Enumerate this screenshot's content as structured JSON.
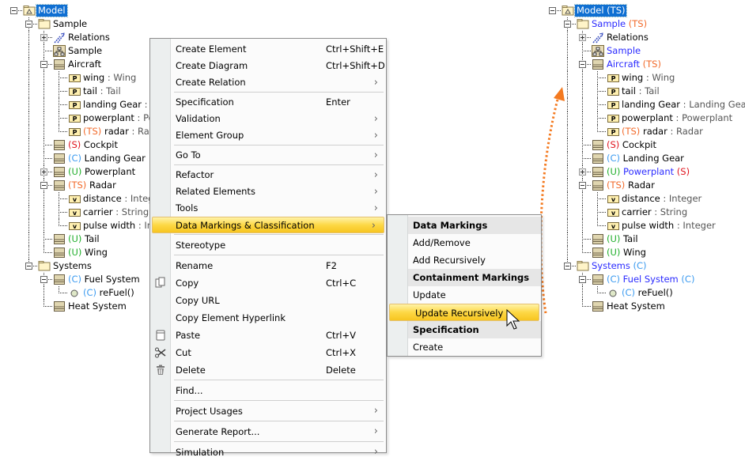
{
  "colors": {
    "accent_selection": "#0f6fd2",
    "highlight": "#fdd845",
    "arrow": "#f47a20",
    "ts": "#f26a2a",
    "s": "#e0141e",
    "c": "#3c9bf0",
    "u": "#1fae2a",
    "modified": "#2a2aff"
  },
  "left_tree": [
    {
      "level": 0,
      "exp": "minus",
      "icon": "model-icon",
      "parts": [
        {
          "t": "Model",
          "c": "sel"
        }
      ]
    },
    {
      "level": 1,
      "exp": "minus",
      "icon": "folder-icon",
      "parts": [
        {
          "t": "Sample"
        }
      ]
    },
    {
      "level": 2,
      "exp": "plus",
      "icon": "relations-icon",
      "parts": [
        {
          "t": "Relations"
        }
      ]
    },
    {
      "level": 2,
      "icon": "diagram-icon",
      "parts": [
        {
          "t": "Sample"
        }
      ]
    },
    {
      "level": 2,
      "exp": "minus",
      "icon": "block-icon",
      "parts": [
        {
          "t": "Aircraft"
        }
      ]
    },
    {
      "level": 3,
      "icon": "property-icon",
      "parts": [
        {
          "t": "wing"
        },
        {
          "t": " : Wing",
          "c": "type"
        }
      ]
    },
    {
      "level": 3,
      "icon": "property-icon",
      "parts": [
        {
          "t": "tail"
        },
        {
          "t": " : Tail",
          "c": "type"
        }
      ]
    },
    {
      "level": 3,
      "icon": "property-icon",
      "parts": [
        {
          "t": "landing Gear"
        },
        {
          "t": " : Landing Gear",
          "c": "type"
        }
      ]
    },
    {
      "level": 3,
      "icon": "property-icon",
      "parts": [
        {
          "t": "powerplant"
        },
        {
          "t": " : Powerplant",
          "c": "type"
        }
      ]
    },
    {
      "level": 3,
      "icon": "property-icon",
      "parts": [
        {
          "t": "(TS)",
          "c": "ts"
        },
        {
          "t": " radar"
        },
        {
          "t": " : Radar",
          "c": "type"
        }
      ]
    },
    {
      "level": 2,
      "icon": "block-icon",
      "parts": [
        {
          "t": "(S)",
          "c": "s"
        },
        {
          "t": " Cockpit"
        }
      ]
    },
    {
      "level": 2,
      "icon": "block-icon",
      "parts": [
        {
          "t": "(C)",
          "c": "c"
        },
        {
          "t": " Landing Gear"
        }
      ]
    },
    {
      "level": 2,
      "exp": "plus",
      "icon": "block-icon",
      "parts": [
        {
          "t": "(U)",
          "c": "u"
        },
        {
          "t": " Powerplant"
        }
      ]
    },
    {
      "level": 2,
      "exp": "minus",
      "icon": "block-icon",
      "parts": [
        {
          "t": "(TS)",
          "c": "ts"
        },
        {
          "t": " Radar"
        }
      ]
    },
    {
      "level": 3,
      "icon": "value-icon",
      "parts": [
        {
          "t": "distance"
        },
        {
          "t": " : Integer",
          "c": "type"
        }
      ]
    },
    {
      "level": 3,
      "icon": "value-icon",
      "parts": [
        {
          "t": "carrier"
        },
        {
          "t": " : String",
          "c": "type"
        }
      ]
    },
    {
      "level": 3,
      "icon": "value-icon",
      "parts": [
        {
          "t": "pulse width"
        },
        {
          "t": " : Integer",
          "c": "type"
        }
      ]
    },
    {
      "level": 2,
      "icon": "block-icon",
      "parts": [
        {
          "t": "(U)",
          "c": "u"
        },
        {
          "t": " Tail"
        }
      ]
    },
    {
      "level": 2,
      "icon": "block-icon",
      "parts": [
        {
          "t": "(U)",
          "c": "u"
        },
        {
          "t": " Wing"
        }
      ]
    },
    {
      "level": 1,
      "exp": "minus",
      "icon": "folder-icon",
      "parts": [
        {
          "t": "Systems"
        }
      ]
    },
    {
      "level": 2,
      "exp": "minus",
      "icon": "block-icon",
      "parts": [
        {
          "t": "(C)",
          "c": "c"
        },
        {
          "t": " Fuel System"
        }
      ]
    },
    {
      "level": 3,
      "icon": "operation-icon",
      "parts": [
        {
          "t": "(C)",
          "c": "c"
        },
        {
          "t": " reFuel()"
        }
      ]
    },
    {
      "level": 2,
      "icon": "block-icon",
      "parts": [
        {
          "t": "Heat System"
        }
      ]
    }
  ],
  "right_tree": [
    {
      "level": 0,
      "exp": "minus",
      "icon": "model-icon",
      "parts": [
        {
          "t": "Model (TS)",
          "c": "sel"
        }
      ]
    },
    {
      "level": 1,
      "exp": "minus",
      "icon": "folder-icon",
      "parts": [
        {
          "t": "Sample",
          "c": "blue"
        },
        {
          "t": " (TS)",
          "c": "ts"
        }
      ]
    },
    {
      "level": 2,
      "exp": "plus",
      "icon": "relations-icon",
      "parts": [
        {
          "t": "Relations"
        }
      ]
    },
    {
      "level": 2,
      "icon": "diagram-icon",
      "parts": [
        {
          "t": "Sample",
          "c": "blue"
        }
      ]
    },
    {
      "level": 2,
      "exp": "minus",
      "icon": "block-icon",
      "parts": [
        {
          "t": "Aircraft",
          "c": "blue"
        },
        {
          "t": " (TS)",
          "c": "ts"
        }
      ]
    },
    {
      "level": 3,
      "icon": "property-icon",
      "parts": [
        {
          "t": "wing"
        },
        {
          "t": " : Wing",
          "c": "type"
        }
      ]
    },
    {
      "level": 3,
      "icon": "property-icon",
      "parts": [
        {
          "t": "tail"
        },
        {
          "t": " : Tail",
          "c": "type"
        }
      ]
    },
    {
      "level": 3,
      "icon": "property-icon",
      "parts": [
        {
          "t": "landing Gear"
        },
        {
          "t": " : Landing Gear",
          "c": "type"
        }
      ]
    },
    {
      "level": 3,
      "icon": "property-icon",
      "parts": [
        {
          "t": "powerplant"
        },
        {
          "t": " : Powerplant",
          "c": "type"
        }
      ]
    },
    {
      "level": 3,
      "icon": "property-icon",
      "parts": [
        {
          "t": "(TS)",
          "c": "ts"
        },
        {
          "t": " radar"
        },
        {
          "t": " : Radar",
          "c": "type"
        }
      ]
    },
    {
      "level": 2,
      "icon": "block-icon",
      "parts": [
        {
          "t": "(S)",
          "c": "s"
        },
        {
          "t": " Cockpit"
        }
      ]
    },
    {
      "level": 2,
      "icon": "block-icon",
      "parts": [
        {
          "t": "(C)",
          "c": "c"
        },
        {
          "t": " Landing Gear"
        }
      ]
    },
    {
      "level": 2,
      "exp": "plus",
      "icon": "block-icon",
      "parts": [
        {
          "t": "(U)",
          "c": "u"
        },
        {
          "t": " Powerplant",
          "c": "blue"
        },
        {
          "t": " (S)",
          "c": "s"
        }
      ]
    },
    {
      "level": 2,
      "exp": "minus",
      "icon": "block-icon",
      "parts": [
        {
          "t": "(TS)",
          "c": "ts"
        },
        {
          "t": " Radar"
        }
      ]
    },
    {
      "level": 3,
      "icon": "value-icon",
      "parts": [
        {
          "t": "distance"
        },
        {
          "t": " : Integer",
          "c": "type"
        }
      ]
    },
    {
      "level": 3,
      "icon": "value-icon",
      "parts": [
        {
          "t": "carrier"
        },
        {
          "t": " : String",
          "c": "type"
        }
      ]
    },
    {
      "level": 3,
      "icon": "value-icon",
      "parts": [
        {
          "t": "pulse width"
        },
        {
          "t": " : Integer",
          "c": "type"
        }
      ]
    },
    {
      "level": 2,
      "icon": "block-icon",
      "parts": [
        {
          "t": "(U)",
          "c": "u"
        },
        {
          "t": " Tail"
        }
      ]
    },
    {
      "level": 2,
      "icon": "block-icon",
      "parts": [
        {
          "t": "(U)",
          "c": "u"
        },
        {
          "t": " Wing"
        }
      ]
    },
    {
      "level": 1,
      "exp": "minus",
      "icon": "folder-icon",
      "parts": [
        {
          "t": "Systems",
          "c": "blue"
        },
        {
          "t": " (C)",
          "c": "c"
        }
      ]
    },
    {
      "level": 2,
      "exp": "minus",
      "icon": "block-icon",
      "parts": [
        {
          "t": "(C)",
          "c": "c"
        },
        {
          "t": " Fuel System",
          "c": "blue"
        },
        {
          "t": " (C)",
          "c": "c"
        }
      ]
    },
    {
      "level": 3,
      "icon": "operation-icon",
      "parts": [
        {
          "t": "(C)",
          "c": "c"
        },
        {
          "t": " reFuel()"
        }
      ]
    },
    {
      "level": 2,
      "icon": "block-icon",
      "parts": [
        {
          "t": "Heat System"
        }
      ]
    }
  ],
  "context_menu": [
    {
      "label": "Create Element",
      "shortcut": "Ctrl+Shift+E"
    },
    {
      "label": "Create Diagram",
      "shortcut": "Ctrl+Shift+D"
    },
    {
      "label": "Create Relation",
      "submenu": true
    },
    {
      "sep": true
    },
    {
      "label": "Specification",
      "shortcut": "Enter"
    },
    {
      "label": "Validation",
      "submenu": true
    },
    {
      "label": "Element Group",
      "submenu": true
    },
    {
      "sep": true
    },
    {
      "label": "Go To",
      "submenu": true
    },
    {
      "sep": true
    },
    {
      "label": "Refactor",
      "submenu": true
    },
    {
      "label": "Related Elements",
      "submenu": true
    },
    {
      "label": "Tools",
      "submenu": true
    },
    {
      "label": "Data Markings & Classification",
      "submenu": true,
      "highlighted": true
    },
    {
      "sep": true
    },
    {
      "label": "Stereotype",
      "tall": true
    },
    {
      "sep": true
    },
    {
      "label": "Rename",
      "shortcut": "F2",
      "tall": true
    },
    {
      "label": "Copy",
      "shortcut": "Ctrl+C",
      "icon": "copy-icon",
      "tall": true
    },
    {
      "label": "Copy URL",
      "tall": true
    },
    {
      "label": "Copy Element Hyperlink",
      "tall": true
    },
    {
      "label": "Paste",
      "shortcut": "Ctrl+V",
      "icon": "paste-icon",
      "tall": true
    },
    {
      "label": "Cut",
      "shortcut": "Ctrl+X",
      "icon": "cut-icon",
      "tall": true
    },
    {
      "label": "Delete",
      "shortcut": "Delete",
      "icon": "delete-icon",
      "tall": true
    },
    {
      "sep": true
    },
    {
      "label": "Find...",
      "tall": true
    },
    {
      "sep": true
    },
    {
      "label": "Project Usages",
      "submenu": true,
      "tall": true
    },
    {
      "sep": true
    },
    {
      "label": "Generate Report...",
      "submenu": true,
      "tall": true
    },
    {
      "sep": true
    },
    {
      "label": "Simulation",
      "submenu": true,
      "tall": true
    }
  ],
  "submenu": [
    {
      "label": "Data Markings",
      "header": true
    },
    {
      "label": "Add/Remove"
    },
    {
      "label": "Add Recursively"
    },
    {
      "label": "Containment Markings",
      "header": true
    },
    {
      "label": "Update"
    },
    {
      "label": "Update Recursively",
      "highlighted": true
    },
    {
      "label": "Specification",
      "header": true
    },
    {
      "label": "Create"
    }
  ]
}
